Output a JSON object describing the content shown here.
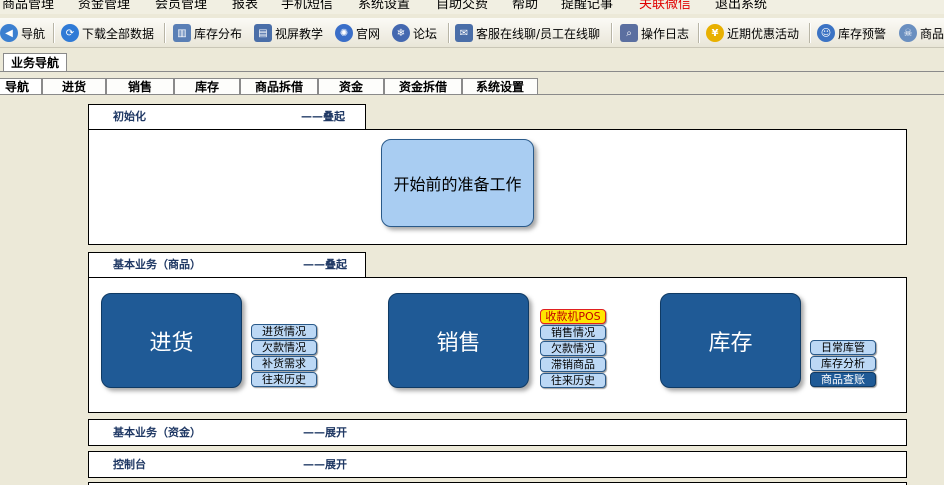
{
  "menu": {
    "items": [
      "商品管理",
      "资金管理",
      "会员管理",
      "报表",
      "手机短信",
      "系统设置",
      "自助交费",
      "帮助",
      "提醒记事",
      "关联微信",
      "退出系统"
    ],
    "highlight_color": "#e00000"
  },
  "toolbar": {
    "items": [
      {
        "label": "导航",
        "icon": "navigation-icon"
      },
      {
        "label": "下载全部数据",
        "icon": "download-icon"
      },
      {
        "label": "库存分布",
        "icon": "inventory-distribution-icon"
      },
      {
        "label": "视屏教学",
        "icon": "video-tutorial-icon"
      },
      {
        "label": "官网",
        "icon": "website-icon"
      },
      {
        "label": "论坛",
        "icon": "forum-icon"
      },
      {
        "label": "客服在线聊/员工在线聊",
        "icon": "chat-icon"
      },
      {
        "label": "操作日志",
        "icon": "log-icon"
      },
      {
        "label": "近期优惠活动",
        "icon": "promotion-icon"
      },
      {
        "label": "库存预警",
        "icon": "stock-alert-icon"
      },
      {
        "label": "商品",
        "icon": "product-icon"
      }
    ]
  },
  "outer_tab": {
    "label": "业务导航"
  },
  "inner_tabs": [
    "导航",
    "进货",
    "销售",
    "库存",
    "商品拆借",
    "资金",
    "资金拆借",
    "系统设置"
  ],
  "sections": {
    "init": {
      "title": "初始化",
      "action": "——叠起",
      "main_button": "开始前的准备工作"
    },
    "goods": {
      "title": "基本业务（商品）",
      "action": "——叠起",
      "purchase": {
        "label": "进货",
        "links": [
          "进货情况",
          "欠款情况",
          "补货需求",
          "往来历史"
        ]
      },
      "sales": {
        "label": "销售",
        "pos": "收款机POS",
        "links": [
          "销售情况",
          "欠款情况",
          "滞销商品",
          "往来历史"
        ]
      },
      "stock": {
        "label": "库存",
        "links": [
          "日常库管",
          "库存分析",
          "商品查账"
        ]
      }
    },
    "funds": {
      "title": "基本业务（资金）",
      "action": "——展开"
    },
    "console": {
      "title": "控制台",
      "action": "——展开"
    }
  },
  "colors": {
    "primary_button": "#1f5a96",
    "light_button": "#a9cdf2",
    "pos_button": "#ffe600"
  }
}
